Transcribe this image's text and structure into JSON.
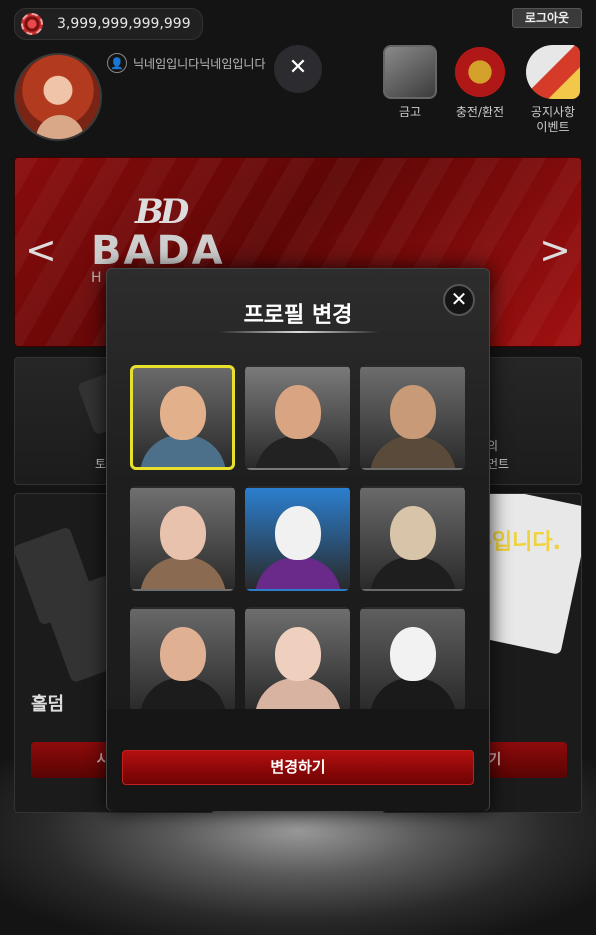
{
  "header": {
    "balance": "3,999,999,999,999",
    "logout_label": "로그아웃",
    "nickname": "닉네임입니다닉네임입니다",
    "close_label": "✕"
  },
  "quick_menu": [
    {
      "label": "금고",
      "icon": "safe-icon"
    },
    {
      "label": "충전/환전",
      "icon": "exchange-icon"
    },
    {
      "label": "공지사항\n이벤트",
      "icon": "notice-megaphone-icon"
    }
  ],
  "banner": {
    "logo_mark": "BD",
    "logo_text": "BADA",
    "sub_text": "H",
    "prev_arrow": "<",
    "next_arrow": ">"
  },
  "background_games": {
    "left_card_label": "토",
    "right_card_label_line1": "의",
    "right_card_label_line2": "먼트",
    "holdem_title": "홀덤",
    "start_left": "시작하",
    "start_right": "작하기",
    "promo": "-입니다."
  },
  "modal": {
    "title": "프로필 변경",
    "close_label": "✕",
    "change_button": "변경하기",
    "selected_index": 0,
    "avatars": [
      {
        "name": "young-man-avatar",
        "face": "#e3b08c",
        "body": "#4c6f8a",
        "bg": "#6a6a6a"
      },
      {
        "name": "mustache-gambler-avatar",
        "face": "#d9a482",
        "body": "#222222",
        "bg": "#7a7a7a"
      },
      {
        "name": "pirate-avatar",
        "face": "#c89a78",
        "body": "#5a4a3a",
        "bg": "#6d6d6d"
      },
      {
        "name": "bubblegum-lady-avatar",
        "face": "#e8c2ad",
        "body": "#8a6a50",
        "bg": "#707070"
      },
      {
        "name": "clown-avatar",
        "face": "#f1f1f1",
        "body": "#6a2a8a",
        "bg": "#2b7fcf"
      },
      {
        "name": "bulldog-avatar",
        "face": "#d8c4a8",
        "body": "#1e1e1e",
        "bg": "#6a6a6a"
      },
      {
        "name": "sunglasses-woman-avatar",
        "face": "#e0b092",
        "body": "#1c1c1c",
        "bg": "#686868"
      },
      {
        "name": "long-hair-woman-avatar",
        "face": "#efcfbd",
        "body": "#d9b3a2",
        "bg": "#6e6e6e"
      },
      {
        "name": "dalmatian-avatar",
        "face": "#f2f2f2",
        "body": "#1a1a1a",
        "bg": "#5f5f5f"
      }
    ]
  },
  "colors": {
    "accent_red": "#8e0b0b",
    "selected_border": "#e8e02a"
  }
}
